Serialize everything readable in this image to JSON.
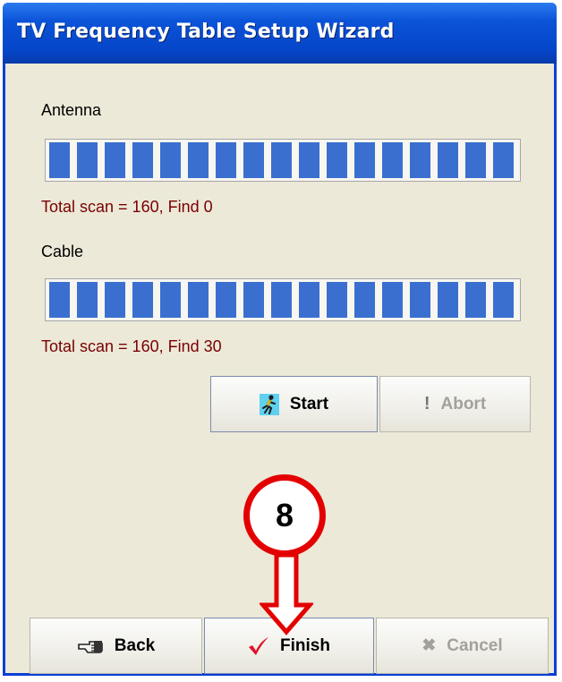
{
  "window": {
    "title": "TV Frequency Table Setup Wizard"
  },
  "antenna": {
    "label": "Antenna",
    "status": "Total scan = 160, Find 0",
    "progress": 1.0,
    "segments": 17
  },
  "cable": {
    "label": "Cable",
    "status": "Total scan = 160, Find 30",
    "progress": 1.0,
    "segments": 17
  },
  "scan_buttons": {
    "start_label": "Start",
    "abort_label": "Abort"
  },
  "nav_buttons": {
    "back_label": "Back",
    "finish_label": "Finish",
    "cancel_label": "Cancel"
  },
  "annotation": {
    "step_number": "8"
  },
  "colors": {
    "progress_fill": "#3a6fd0",
    "status_text": "#7a0000",
    "callout": "#e30000",
    "title_bar": "#0b53d8"
  }
}
